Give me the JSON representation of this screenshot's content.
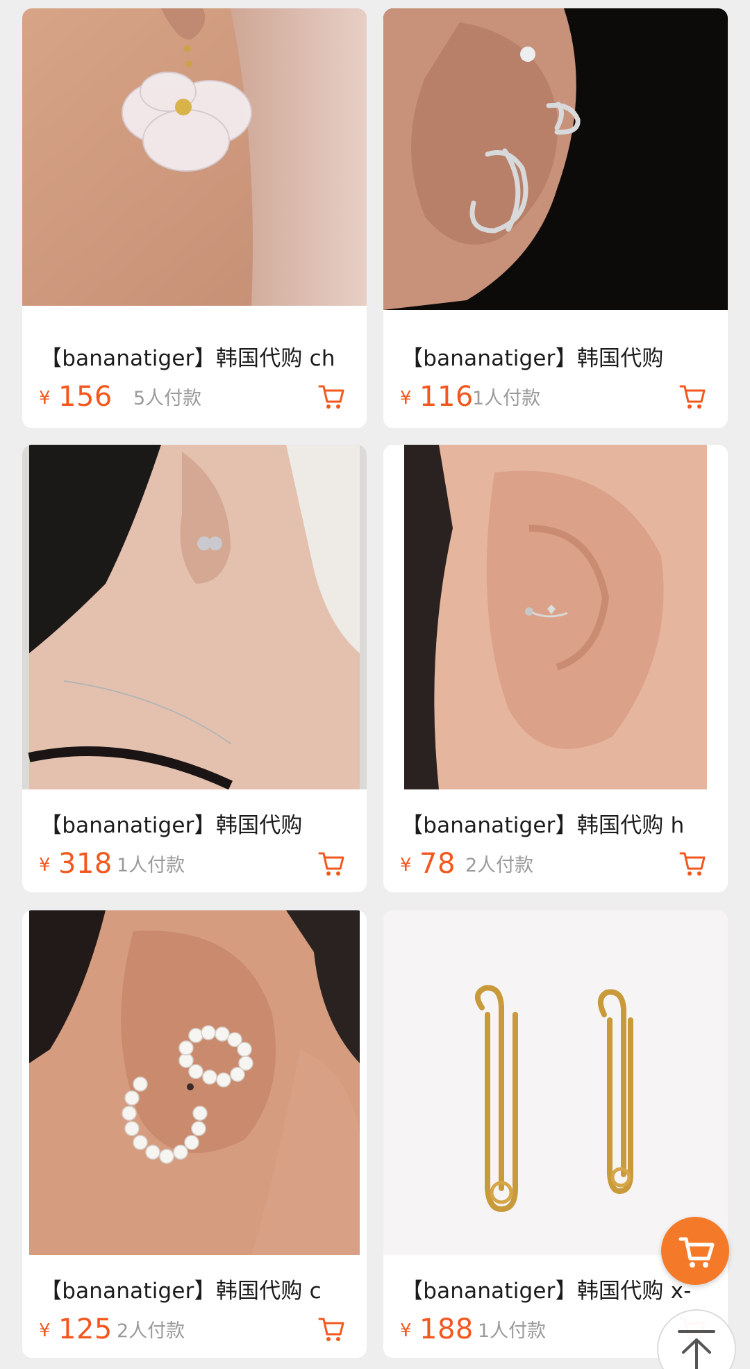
{
  "products": [
    {
      "title": "【bananatiger】韩国代购 ch",
      "currency": "¥",
      "price": "156",
      "sold": "5人付款",
      "cart_icon": "cart-icon"
    },
    {
      "title": "【bananatiger】韩国代购",
      "currency": "¥",
      "price": "116",
      "sold": "1人付款",
      "cart_icon": "cart-icon"
    },
    {
      "title": "【bananatiger】韩国代购",
      "currency": "¥",
      "price": "318",
      "sold": "1人付款",
      "cart_icon": "cart-icon"
    },
    {
      "title": "【bananatiger】韩国代购  h",
      "currency": "¥",
      "price": "78",
      "sold": "2人付款",
      "cart_icon": "cart-icon"
    },
    {
      "title": "【bananatiger】韩国代购  c",
      "currency": "¥",
      "price": "125",
      "sold": "2人付款",
      "cart_icon": "cart-icon"
    },
    {
      "title": "【bananatiger】韩国代购 x-",
      "currency": "¥",
      "price": "188",
      "sold": "1人付款",
      "cart_icon": "cart-icon"
    }
  ],
  "floating": {
    "cart_button_icon": "shopping-cart-icon",
    "back_to_top_icon": "arrow-up-icon"
  },
  "colors": {
    "price": "#f2581e",
    "fab": "#f47a2a",
    "background": "#eeeeee"
  }
}
